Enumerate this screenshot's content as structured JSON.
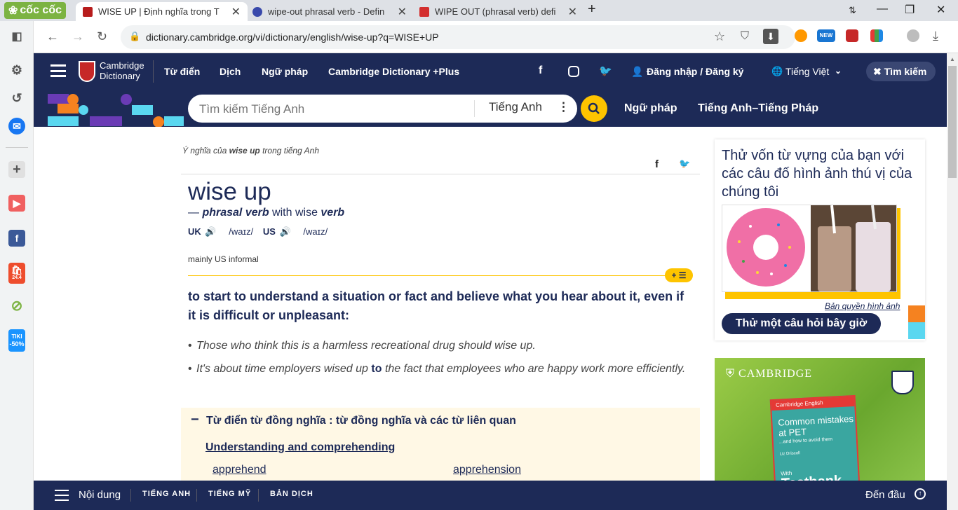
{
  "browser": {
    "brand": "cốc cốc",
    "tabs": [
      {
        "title": "WISE UP | Định nghĩa trong T",
        "active": true
      },
      {
        "title": "wipe-out phrasal verb - Defin",
        "active": false
      },
      {
        "title": "WIPE OUT (phrasal verb) defi",
        "active": false
      }
    ],
    "url": "dictionary.cambridge.org/vi/dictionary/english/wise-up?q=WISE+UP",
    "ext_new_badge": "NEW",
    "sidebar_badges": {
      "shopee": "24.4",
      "tiki_name": "TIKI",
      "tiki_discount": "-50%"
    }
  },
  "cambridge": {
    "logo_line1": "Cambridge",
    "logo_line2": "Dictionary",
    "nav": [
      "Từ điển",
      "Dịch",
      "Ngữ pháp",
      "Cambridge Dictionary +Plus"
    ],
    "login": "Đăng nhập / Đăng ký",
    "language": "Tiếng Việt",
    "search_toggle": "Tìm kiếm",
    "search_placeholder": "Tìm kiếm Tiếng Anh",
    "search_lang": "Tiếng Anh",
    "search_links": [
      "Ngữ pháp",
      "Tiếng Anh–Tiếng Pháp"
    ]
  },
  "entry": {
    "crumb_prefix": "Ý nghĩa của ",
    "crumb_word": "wise up",
    "crumb_suffix": " trong tiếng Anh",
    "headword": "wise up",
    "pos_dash": "— ",
    "pos": "phrasal verb",
    "pos_with": " with wise ",
    "pos_verb": "verb",
    "uk_label": "UK",
    "uk_ipa": "/waɪz/",
    "us_label": "US",
    "us_ipa": "/waɪz/",
    "usage": "mainly US informal",
    "plus_label": "+",
    "definition": "to start to understand a situation or fact and believe what you hear about it, even if it is difficult or unpleasant:",
    "example1": "Those who think this is a harmless recreational drug should wise up.",
    "example2_a": "It's about time employers wised up ",
    "example2_b": "to",
    "example2_c": " the fact that employees who are happy work more efficiently.",
    "thesaurus_title": "Từ điển từ đồng nghĩa : từ đồng nghĩa và các từ liên quan",
    "thesaurus_minus": "−",
    "thesaurus_heading": "Understanding and comprehending",
    "synonyms": [
      "apprehend",
      "apprehension"
    ]
  },
  "ad": {
    "quiz_text": "Thử vốn từ vựng của bạn với các câu đố hình ảnh thú vị của chúng tôi",
    "copyright": "Bản quyền hình ảnh",
    "quiz_button": "Thử một câu hỏi bây giờ",
    "cambridge_brand": "CAMBRIDGE",
    "book_series": "Cambridge English",
    "book_title": "Common mistakes at PET",
    "book_subtitle": "...and how to avoid them",
    "book_author": "Liz Driscoll",
    "book_with": "With",
    "book_footer": "Testbank"
  },
  "bottom": {
    "contents": "Nội dung",
    "links": [
      "TIẾNG ANH",
      "TIẾNG MỸ",
      "BẢN DỊCH"
    ],
    "top": "Đến đầu"
  },
  "colors": {
    "navy": "#1d2a57",
    "yellow": "#fec400",
    "cream": "#fff8e5"
  }
}
